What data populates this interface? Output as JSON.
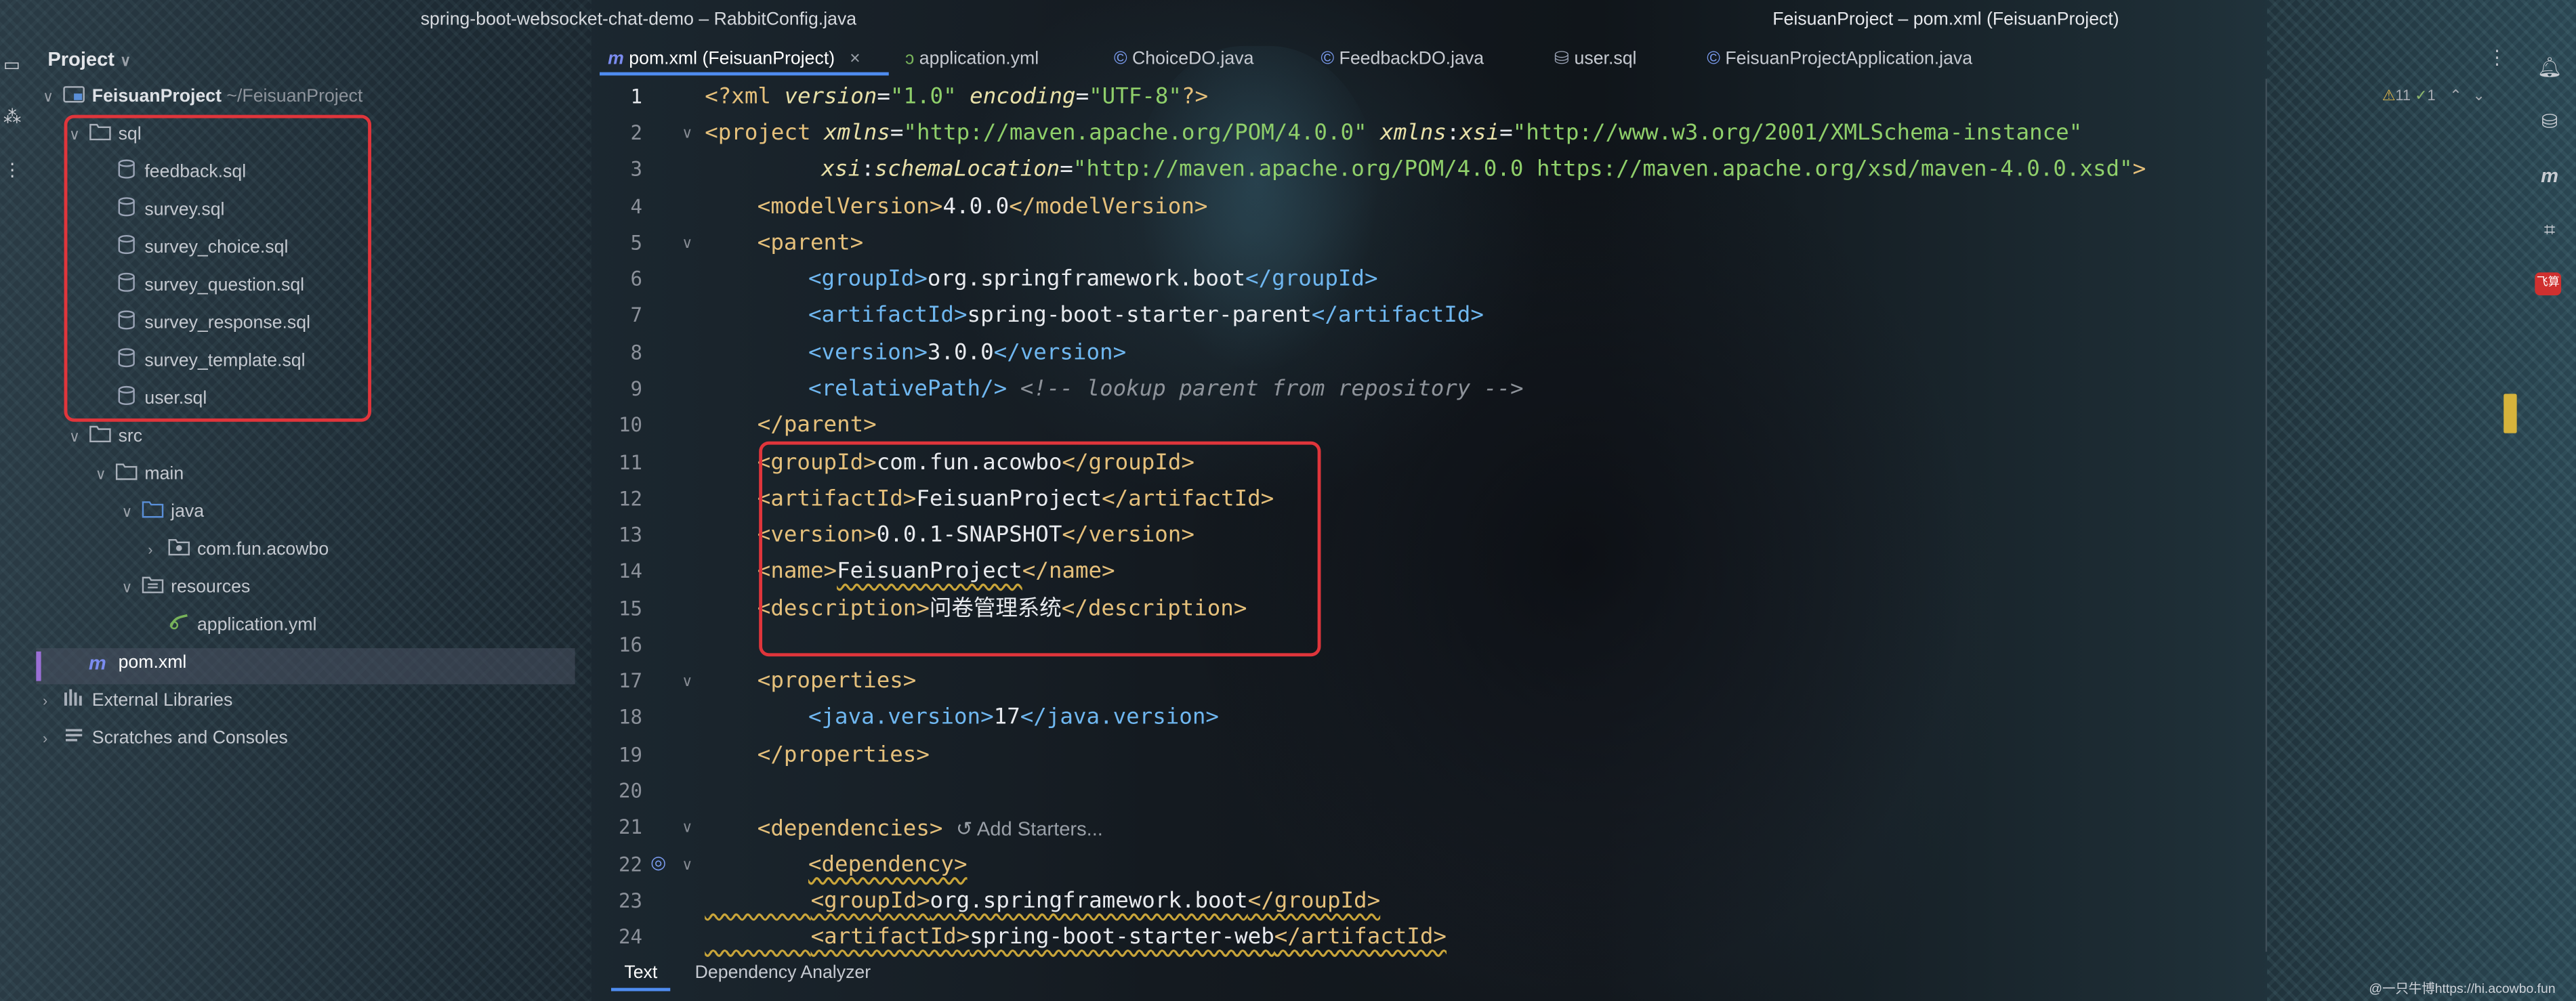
{
  "window": {
    "left_title": "spring-boot-websocket-chat-demo – RabbitConfig.java",
    "right_title": "FeisuanProject – pom.xml (FeisuanProject)"
  },
  "project_panel": {
    "header": "Project",
    "tree": [
      {
        "label": "FeisuanProject",
        "aside": "~/FeisuanProject",
        "icon": "module-icon",
        "expanded": true
      },
      {
        "label": "sql",
        "icon": "folder-icon",
        "expanded": true
      },
      {
        "label": "feedback.sql",
        "icon": "sql-file-icon"
      },
      {
        "label": "survey.sql",
        "icon": "sql-file-icon"
      },
      {
        "label": "survey_choice.sql",
        "icon": "sql-file-icon"
      },
      {
        "label": "survey_question.sql",
        "icon": "sql-file-icon"
      },
      {
        "label": "survey_response.sql",
        "icon": "sql-file-icon"
      },
      {
        "label": "survey_template.sql",
        "icon": "sql-file-icon"
      },
      {
        "label": "user.sql",
        "icon": "sql-file-icon"
      },
      {
        "label": "src",
        "icon": "folder-icon",
        "expanded": true
      },
      {
        "label": "main",
        "icon": "folder-icon",
        "expanded": true
      },
      {
        "label": "java",
        "icon": "source-folder-icon",
        "expanded": true
      },
      {
        "label": "com.fun.acowbo",
        "icon": "package-icon",
        "expanded": false
      },
      {
        "label": "resources",
        "icon": "resources-folder-icon",
        "expanded": true
      },
      {
        "label": "application.yml",
        "icon": "yaml-file-icon"
      },
      {
        "label": "pom.xml",
        "icon": "maven-icon",
        "selected": true
      },
      {
        "label": "External Libraries",
        "icon": "libraries-icon",
        "expanded": false
      },
      {
        "label": "Scratches and Consoles",
        "icon": "scratches-icon",
        "expanded": false
      }
    ]
  },
  "editor": {
    "tabs": [
      {
        "label": "pom.xml (FeisuanProject)",
        "icon": "maven-icon",
        "active": true
      },
      {
        "label": "application.yml",
        "icon": "yaml-file-icon"
      },
      {
        "label": "ChoiceDO.java",
        "icon": "class-icon"
      },
      {
        "label": "FeedbackDO.java",
        "icon": "class-icon"
      },
      {
        "label": "user.sql",
        "icon": "sql-file-icon"
      },
      {
        "label": "FeisuanProjectApplication.java",
        "icon": "class-icon"
      }
    ],
    "inspection": {
      "warnings": "11",
      "checks": "1"
    },
    "lines": [
      "1",
      "2",
      "3",
      "4",
      "5",
      "6",
      "7",
      "8",
      "9",
      "10",
      "11",
      "12",
      "13",
      "14",
      "15",
      "16",
      "17",
      "18",
      "19",
      "20",
      "21",
      "22",
      "23",
      "24"
    ],
    "code": {
      "l1": {
        "a": "<?xml ",
        "b": "version",
        "c": "=",
        "d": "\"1.0\"",
        "e": " encoding",
        "f": "=",
        "g": "\"UTF-8\"",
        "h": "?>"
      },
      "l2": {
        "a": "<project ",
        "b": "xmlns",
        "c": "=",
        "d": "\"http://maven.apache.org/POM/4.0.0\"",
        "e": " xmlns",
        "f": ":",
        "g": "xsi",
        "h": "=",
        "i": "\"http://www.w3.org/2001/XMLSchema-instance\""
      },
      "l3": {
        "a": "xsi",
        "b": ":",
        "c": "schemaLocation",
        "d": "=",
        "e": "\"http://maven.apache.org/POM/4.0.0 https://maven.apache.org/xsd/maven-4.0.0.xsd\"",
        "f": ">"
      },
      "l4": {
        "open": "<modelVersion>",
        "val": "4.0.0",
        "close": "</modelVersion>"
      },
      "l5": "<parent>",
      "l6": {
        "open": "<groupId>",
        "val": "org.springframework.boot",
        "close": "</groupId>"
      },
      "l7": {
        "open": "<artifactId>",
        "val": "spring-boot-starter-parent",
        "close": "</artifactId>"
      },
      "l8": {
        "open": "<version>",
        "val": "3.0.0",
        "close": "</version>"
      },
      "l9": {
        "tag": "<relativePath/>",
        "comment": " <!-- lookup parent from repository -->"
      },
      "l10": "</parent>",
      "l11": {
        "open": "<groupId>",
        "val": "com.fun.acowbo",
        "close": "</groupId>"
      },
      "l12": {
        "open": "<artifactId>",
        "val": "FeisuanProject",
        "close": "</artifactId>"
      },
      "l13": {
        "open": "<version>",
        "val": "0.0.1-SNAPSHOT",
        "close": "</version>"
      },
      "l14": {
        "open": "<name>",
        "val": "FeisuanProject",
        "close": "</name>"
      },
      "l15": {
        "open": "<description>",
        "val": "问卷管理系统",
        "close": "</description>"
      },
      "l17": "<properties>",
      "l18": {
        "open": "<java.version>",
        "val": "17",
        "close": "</java.version>"
      },
      "l19": "</properties>",
      "l21": {
        "tag": "<dependencies>",
        "hint": "Add Starters..."
      },
      "l22": "<dependency>",
      "l23": {
        "open": "<groupId>",
        "val": "org.springframework.boot",
        "close": "</groupId>"
      },
      "l24": {
        "open": "<artifactId>",
        "val": "spring-boot-starter-web",
        "close": "</artifactId>"
      }
    }
  },
  "bottom_tabs": [
    {
      "label": "Text",
      "active": true
    },
    {
      "label": "Dependency Analyzer"
    }
  ],
  "right_toolbar": [
    {
      "icon": "notifications-icon"
    },
    {
      "icon": "database-icon"
    },
    {
      "icon": "maven-icon"
    },
    {
      "icon": "structure-icon"
    },
    {
      "icon": "plugin-badge-icon",
      "label": "飞算"
    }
  ],
  "watermark": "@一只牛博https://hi.acowbo.fun",
  "colors": {
    "accent": "#4f8cf0",
    "highlight_box": "#e0353b",
    "selection_bar": "#9a6fd6"
  }
}
